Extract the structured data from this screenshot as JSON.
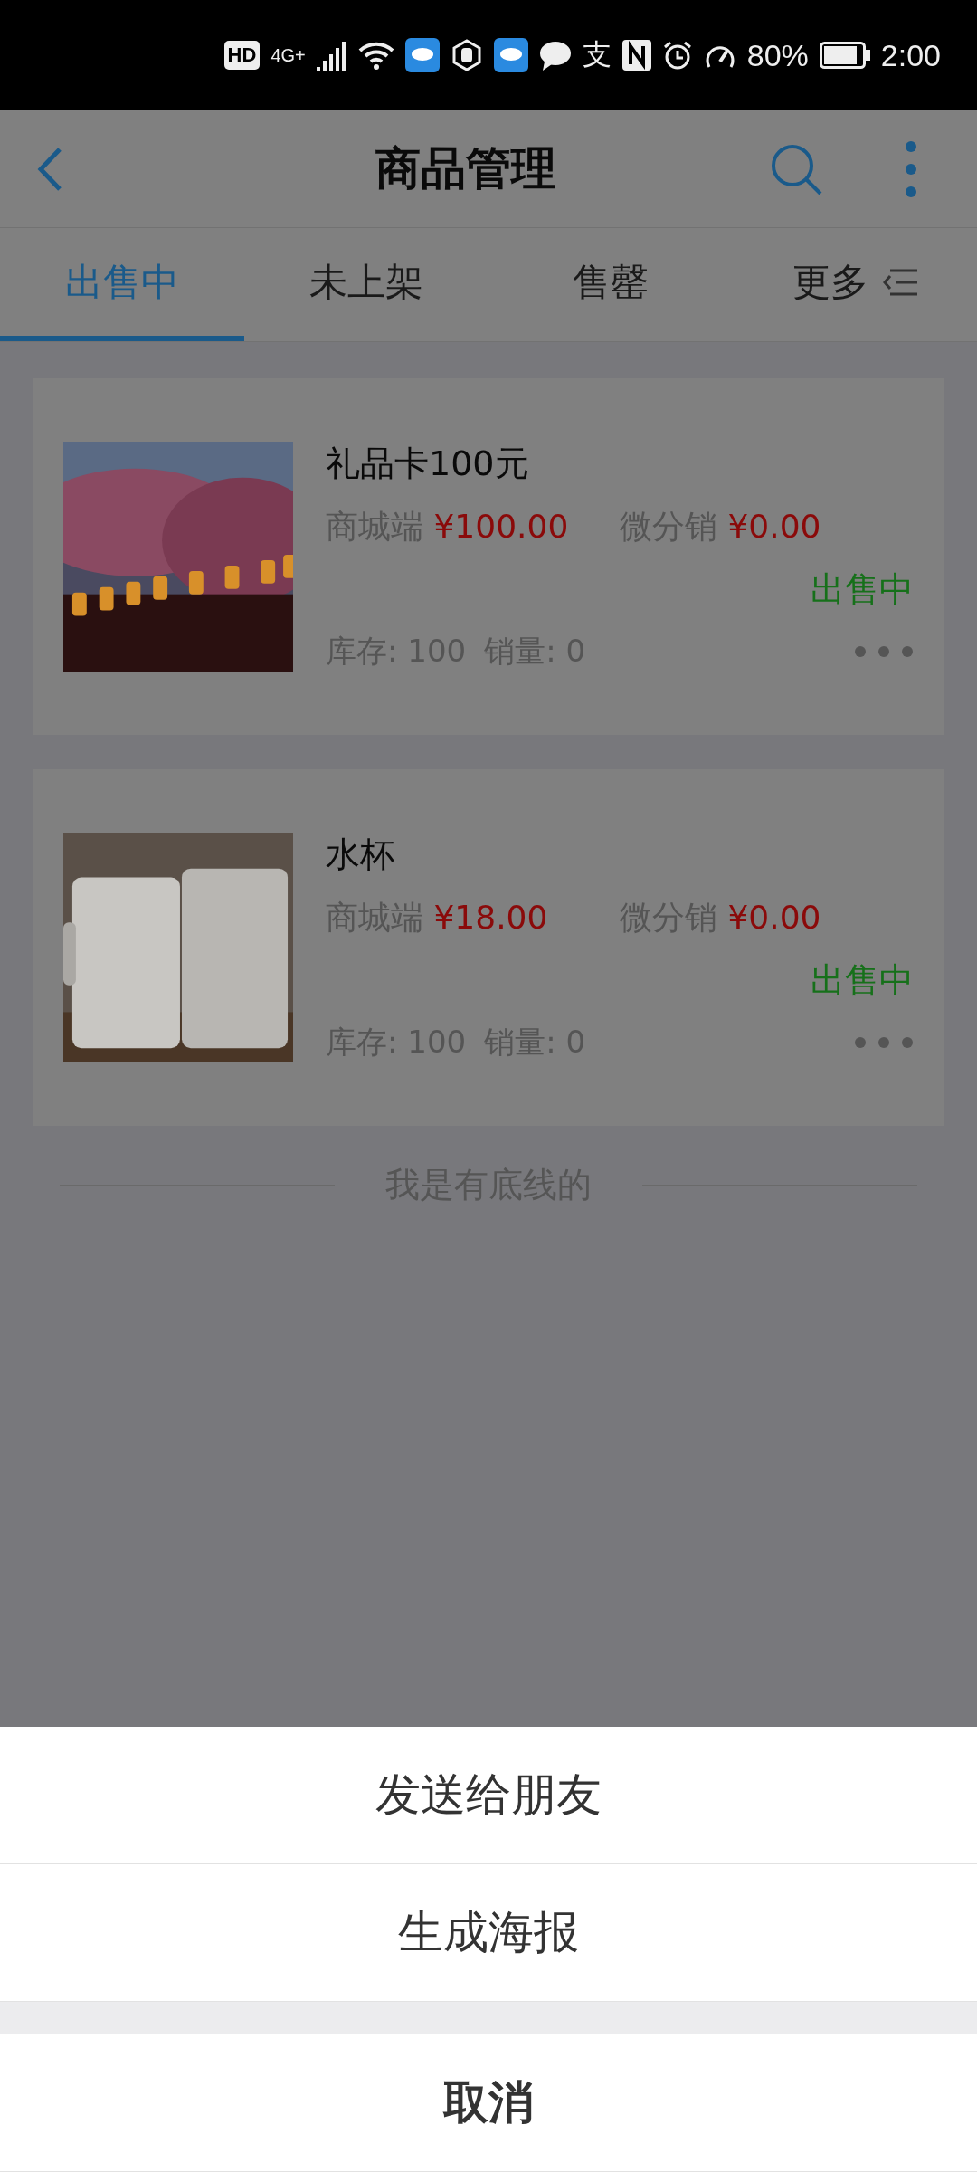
{
  "status_bar": {
    "hd": "HD",
    "network": "4G+",
    "glyph": "支",
    "battery": "80%",
    "time": "2:00"
  },
  "header": {
    "title": "商品管理"
  },
  "tabs": [
    {
      "label": "出售中",
      "selected": true
    },
    {
      "label": "未上架",
      "selected": false
    },
    {
      "label": "售罄",
      "selected": false
    },
    {
      "label": "更多",
      "selected": false,
      "kind": "menu"
    }
  ],
  "products": [
    {
      "name": "礼品卡100元",
      "mall_label": "商城端",
      "mall_price": "¥100.00",
      "dist_label": "微分销",
      "dist_price": "¥0.00",
      "status": "出售中",
      "stock": "库存: 100",
      "sales": "销量: 0"
    },
    {
      "name": "水杯",
      "mall_label": "商城端",
      "mall_price": "¥18.00",
      "dist_label": "微分销",
      "dist_price": "¥0.00",
      "status": "出售中",
      "stock": "库存: 100",
      "sales": "销量: 0"
    }
  ],
  "end_note": "我是有底线的",
  "action_sheet": {
    "actions": [
      "发送给朋友",
      "生成海报"
    ],
    "cancel": "取消"
  }
}
